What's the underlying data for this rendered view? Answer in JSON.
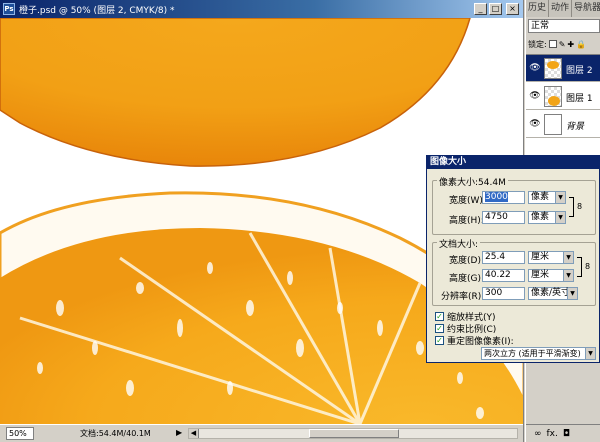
{
  "doc_window": {
    "app_badge": "Ps",
    "title": "橙子.psd @ 50% (图层 2, CMYK/8) *",
    "buttons": {
      "minimize": "_",
      "maximize": "□",
      "close": "×"
    }
  },
  "status_bar": {
    "zoom": "50%",
    "doc_size": "文档:54.4M/40.1M",
    "arrow": "▶",
    "scroll_left": "◀"
  },
  "layers_panel": {
    "tabs": [
      "历史",
      "动作",
      "导航器"
    ],
    "blend_mode": "正常",
    "lock_label": "锁定:",
    "lock_glyphs": [
      "✎",
      "✚",
      "🔒"
    ],
    "layers": [
      {
        "name": "图层 2",
        "selected": true,
        "eye": "👁"
      },
      {
        "name": "图层 1",
        "selected": false,
        "eye": "👁"
      },
      {
        "name": "背景",
        "selected": false,
        "eye": "👁"
      }
    ],
    "footer_icons": [
      "∞",
      "fx.",
      "◘"
    ]
  },
  "image_size_dialog": {
    "title": "图像大小",
    "pixel_dimensions": {
      "legend": "像素大小:54.4M",
      "width_label": "宽度(W):",
      "width_value": "3000",
      "width_unit": "像素",
      "height_label": "高度(H):",
      "height_value": "4750",
      "height_unit": "像素"
    },
    "document_size": {
      "legend": "文档大小:",
      "width_label": "宽度(D):",
      "width_value": "25.4",
      "width_unit": "厘米",
      "height_label": "高度(G):",
      "height_value": "40.22",
      "height_unit": "厘米",
      "resolution_label": "分辨率(R):",
      "resolution_value": "300",
      "resolution_unit": "像素/英寸"
    },
    "checkboxes": [
      {
        "label": "缩放样式(Y)",
        "checked": true
      },
      {
        "label": "约束比例(C)",
        "checked": true
      },
      {
        "label": "重定图像像素(I):",
        "checked": true
      }
    ],
    "resample_method": "两次立方 (适用于平滑渐变)",
    "check_mark": "✓",
    "select_arrow": "▼",
    "chain_glyph": "8"
  },
  "colors": {
    "orange_dark": "#e8860a",
    "orange_mid": "#f4a81c",
    "orange_light": "#fbc53a",
    "selection_blue": "#0a246a"
  }
}
